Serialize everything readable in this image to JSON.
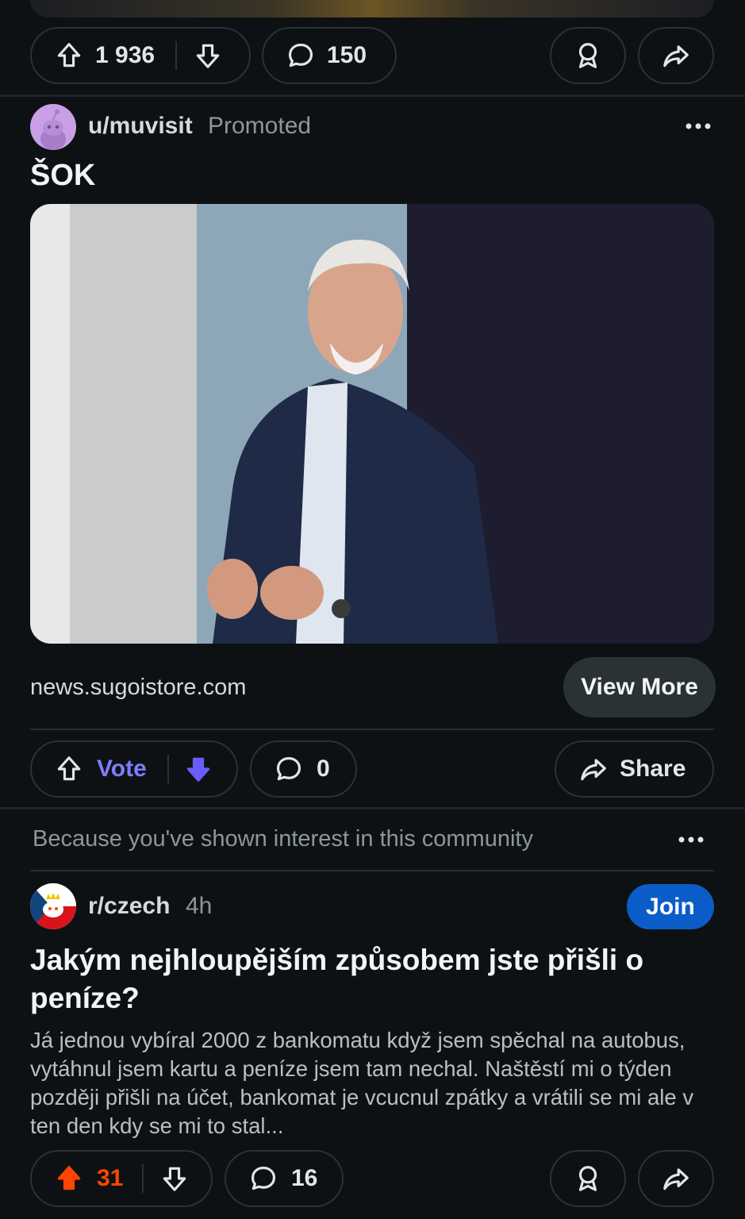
{
  "top_post": {
    "upvotes": "1 936",
    "comments": "150"
  },
  "promoted_post": {
    "username": "u/muvisit",
    "tag": "Promoted",
    "title": "ŠOK",
    "domain": "news.sugoistore.com",
    "cta_label": "View More",
    "vote_label": "Vote",
    "comments": "0",
    "share_label": "Share"
  },
  "recommendation": {
    "reason": "Because you've shown interest in this community"
  },
  "community_post": {
    "subreddit": "r/czech",
    "age": "4h",
    "join_label": "Join",
    "title": "Jakým nejhloupějším způsobem jste přišli o peníze?",
    "body": "Já jednou vybíral 2000 z bankomatu když jsem spěchal na autobus, vytáhnul jsem kartu a peníze jsem tam nechal. Naštěstí mi o týden později přišli na účet, bankomat je vcucnul zpátky a vrátili se mi ale v ten den kdy se mi to stal...",
    "upvotes": "31",
    "comments": "16"
  },
  "colors": {
    "background": "#0e1113",
    "upvote_active": "#ff4500",
    "downvote_active": "#6a5cff",
    "vote_label": "#7f7cff",
    "join_button": "#0a5dc9"
  },
  "icons": [
    "upvote-icon",
    "downvote-icon",
    "comment-icon",
    "award-icon",
    "share-icon",
    "more-icon",
    "avatar-icon"
  ]
}
